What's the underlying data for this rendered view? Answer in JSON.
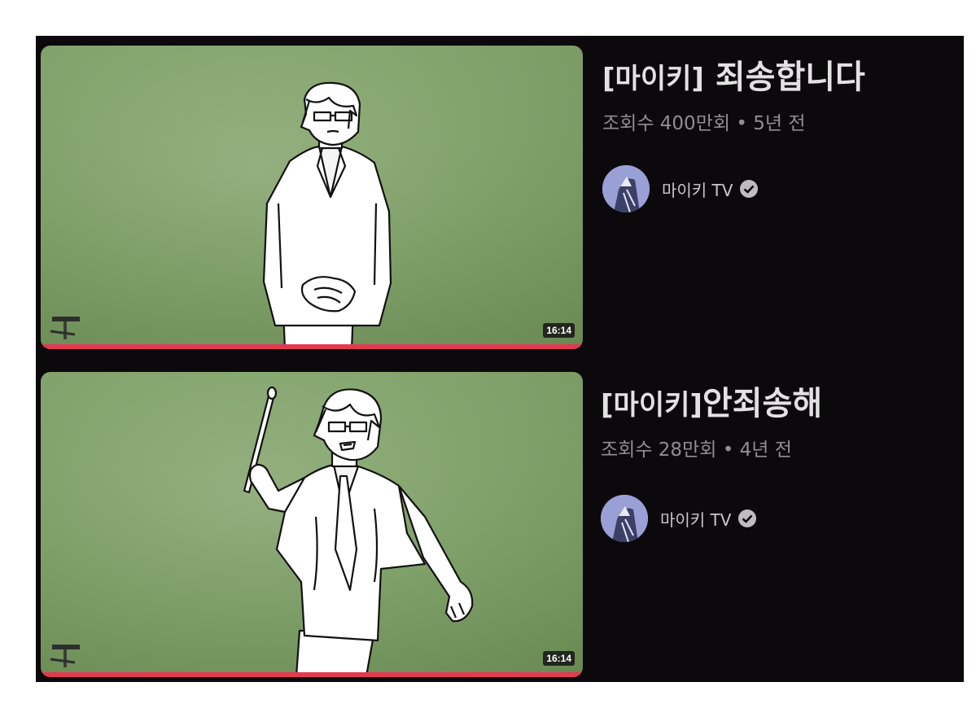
{
  "videos": [
    {
      "title_bracket": "[마이키]",
      "title_main": " 죄송합니다",
      "views": "조회수 400만회",
      "separator": " • ",
      "age": "5년 전",
      "channel": "마이키  TV",
      "duration": "16:14",
      "progress": 1.0
    },
    {
      "title_bracket": "[마이키]",
      "title_main": "안죄송해",
      "views": "조회수 28만회",
      "separator": " • ",
      "age": "4년 전",
      "channel": "마이키  TV",
      "duration": "16:14",
      "progress": 1.0
    }
  ],
  "colors": {
    "background": "#0b090b",
    "title": "#e2e2e2",
    "meta": "#8f8f8f",
    "progress": "#e23a52",
    "thumbnail_green": "#81a36a"
  },
  "icons": {
    "verified": "verified-check-icon"
  }
}
